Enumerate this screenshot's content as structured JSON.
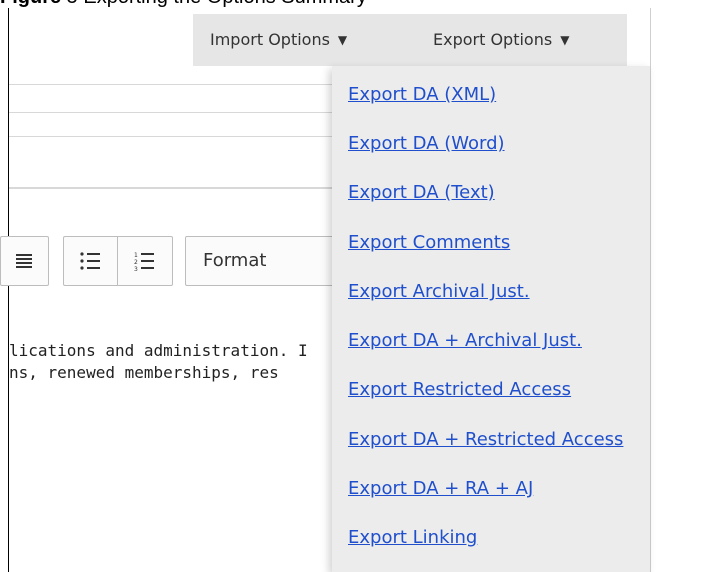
{
  "caption": {
    "bold_text": "Figure",
    "text": " 5 Exporting the Options Summary"
  },
  "toolbar": {
    "import_label": "Import Options",
    "export_label": "Export Options",
    "dropdown_arrow": "▼",
    "format_label": "Format"
  },
  "export_menu": {
    "items": [
      "Export DA (XML)",
      "Export DA (Word)",
      "Export DA (Text)",
      "Export Comments",
      "Export Archival Just.",
      "Export DA + Archival Just.",
      "Export Restricted Access",
      "Export DA + Restricted Access",
      "Export DA + RA + AJ",
      "Export Linking"
    ]
  },
  "editor": {
    "lines": [
      "lications and administration. I",
      "ns, renewed memberships, res"
    ]
  },
  "icons": {
    "justify": "justify-icon",
    "bullet_list": "bullet-list-icon",
    "numbered_list": "numbered-list-icon"
  },
  "colors": {
    "link": "#1f4fcc",
    "menu_bg": "#ececec",
    "bar_bg": "#e6e6e6"
  }
}
